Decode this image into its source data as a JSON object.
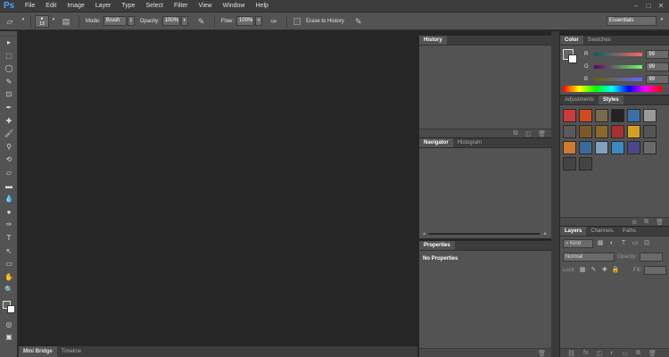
{
  "app": {
    "logo": "Ps"
  },
  "menu": [
    "File",
    "Edit",
    "Image",
    "Layer",
    "Type",
    "Select",
    "Filter",
    "View",
    "Window",
    "Help"
  ],
  "window_controls": {
    "minimize": "–",
    "maximize": "□",
    "close": "✕"
  },
  "options": {
    "mode_label": "Mode:",
    "mode_value": "Brush",
    "opacity_label": "Opacity:",
    "opacity_value": "100%",
    "flow_label": "Flow:",
    "flow_value": "100%",
    "erase_history_label": "Erase to History",
    "brush_size": "13",
    "workspace": "Essentials"
  },
  "tools": [
    "move-icon",
    "marquee-icon",
    "lasso-icon",
    "quick-select-icon",
    "crop-icon",
    "eyedropper-icon",
    "healing-icon",
    "brush-icon",
    "clone-stamp-icon",
    "history-brush-icon",
    "eraser-icon",
    "gradient-icon",
    "blur-icon",
    "dodge-icon",
    "pen-icon",
    "type-icon",
    "path-select-icon",
    "shape-icon",
    "hand-icon",
    "zoom-icon"
  ],
  "tool_glyphs": [
    "▸",
    "⬚",
    "◯",
    "✎",
    "⊡",
    "✒",
    "✚",
    "🖌",
    "⚲",
    "⟲",
    "▱",
    "▬",
    "💧",
    "●",
    "✑",
    "T",
    "↖",
    "▭",
    "✋",
    "🔍"
  ],
  "bottom_tabs": [
    "Mini Bridge",
    "Timeline"
  ],
  "history": {
    "tab": "History"
  },
  "navigator": {
    "tabs": [
      "Navigator",
      "Histogram"
    ]
  },
  "properties": {
    "tab": "Properties",
    "content": "No Properties"
  },
  "color": {
    "tabs": [
      "Color",
      "Swatches"
    ],
    "r_label": "R",
    "g_label": "G",
    "b_label": "B",
    "r": "99",
    "g": "99",
    "b": "99"
  },
  "adjustments": {
    "tabs": [
      "Adjustments",
      "Styles"
    ]
  },
  "layers": {
    "tabs": [
      "Layers",
      "Channels",
      "Paths"
    ],
    "kind": "Kind",
    "blend": "Normal",
    "opacity_label": "Opacity:",
    "lock_label": "Lock:",
    "fill_label": "Fill:"
  },
  "style_swatches": [
    "#cc3a3a",
    "#d24a1e",
    "#7a6a4a",
    "#222222",
    "#3b6fa8",
    "#999999",
    "#5a5a5a",
    "#7a5a2a",
    "#8a6a2a",
    "#a83030",
    "#d4a020",
    "#555555",
    "#d07a30",
    "#3a6a9a",
    "#80a0c0",
    "#3a8ac0",
    "#4a4a8a",
    "#6a6a6a",
    "#444444",
    "#444444"
  ]
}
